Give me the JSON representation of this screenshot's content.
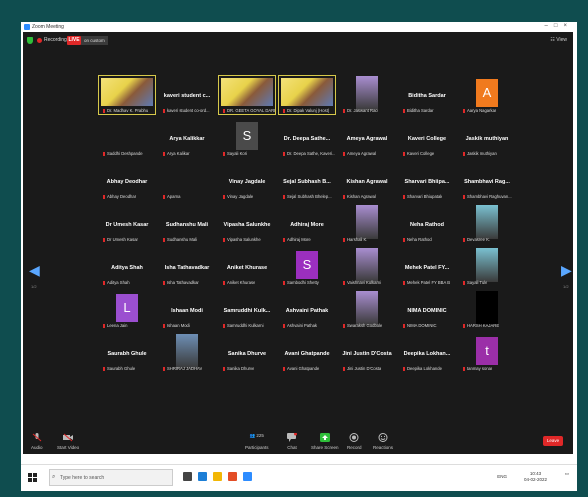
{
  "window": {
    "title": "Zoom Meeting"
  },
  "topbar": {
    "recording_label": "Recording",
    "live_badge": "LIVE",
    "live_stream_label": "on custom",
    "view_label": "View"
  },
  "nav": {
    "prev_page": "1/2",
    "next_page": "1/2"
  },
  "tiles": [
    {
      "type": "poster",
      "caption": "Dr. Madhav K. Prabhu"
    },
    {
      "type": "name",
      "name": "kaveri student c...",
      "caption": "kaveri student co-ord..."
    },
    {
      "type": "poster",
      "caption": "DR. GEETA GOYAL DARE"
    },
    {
      "type": "poster",
      "caption": "Dr. Dipak Valunj (Host)"
    },
    {
      "type": "photo",
      "caption": "Dr. Jaswant Rao"
    },
    {
      "type": "name",
      "name": "Biditha Sardar",
      "caption": "Biditha Sardar"
    },
    {
      "type": "avatar",
      "letter": "A",
      "color": "#f07a1e",
      "caption": "Aarya Nagarkar"
    },
    {
      "type": "name",
      "name": "",
      "caption": "Saddhi Deshpande"
    },
    {
      "type": "name",
      "name": "Arya Kalikkar",
      "caption": "Arya Kalikar"
    },
    {
      "type": "avatar",
      "letter": "S",
      "color": "#4a4a4a",
      "caption": "Sayali Kori"
    },
    {
      "type": "name",
      "name": "Dr. Deepa Sathe...",
      "caption": "Dr. Deepa Sathe, Kaveri..."
    },
    {
      "type": "name",
      "name": "Ameya Agrawal",
      "caption": "Ameya Agrawal"
    },
    {
      "type": "name",
      "name": "Kaveri College",
      "caption": "Kaveri College"
    },
    {
      "type": "name",
      "name": "Jaskik muthiyan",
      "caption": "Jaskik muthiyan"
    },
    {
      "type": "name",
      "name": "Abhay Deodhar",
      "caption": "Abhay Deodhar"
    },
    {
      "type": "name",
      "name": "",
      "caption": "Aparna"
    },
    {
      "type": "name",
      "name": "Vinay Jagdale",
      "caption": "Vinay Jagdale"
    },
    {
      "type": "name",
      "name": "Sejal Subhash B...",
      "caption": "Sejal Subhash Bhelep..."
    },
    {
      "type": "name",
      "name": "Kishan Agrawal",
      "caption": "Kishan Agrawal"
    },
    {
      "type": "name",
      "name": "Sharvari Bhiipa...",
      "caption": "Sharvari Bhiupatak"
    },
    {
      "type": "name",
      "name": "Shambhavi Rag...",
      "caption": "Shambhavi Raghuvan..."
    },
    {
      "type": "name",
      "name": "Dr Umesh Kasar",
      "caption": "Dr Umesh Kasar"
    },
    {
      "type": "name",
      "name": "Sudhanshu Mali",
      "caption": "Sudhanshu Mali"
    },
    {
      "type": "name",
      "name": "Vipasha Salunkhe",
      "caption": "Vipasha Salunkhe"
    },
    {
      "type": "name",
      "name": "Adhiraj More",
      "caption": "Adhiraj More"
    },
    {
      "type": "photo",
      "caption": "Harshali K."
    },
    {
      "type": "name",
      "name": "Neha Rathod",
      "caption": "Neha Rathod"
    },
    {
      "type": "photo",
      "caption": "Devasree K."
    },
    {
      "type": "name",
      "name": "Aditya Shah",
      "caption": "Aditya Shah"
    },
    {
      "type": "name",
      "name": "Isha Tathavadkar",
      "caption": "Isha Tathavadkar"
    },
    {
      "type": "name",
      "name": "Aniket Khurase",
      "caption": "Aniket Khurase"
    },
    {
      "type": "avatar",
      "letter": "S",
      "color": "#9b2fbf",
      "caption": "Sambodhi Shetty"
    },
    {
      "type": "photo",
      "caption": "Vaishnavi Kulkarni"
    },
    {
      "type": "name",
      "name": "Mehek Patel FY...",
      "caption": "Mehek Patel FY BBA B"
    },
    {
      "type": "photo",
      "caption": "Sayali Tule"
    },
    {
      "type": "avatar",
      "letter": "L",
      "color": "#9b4fd0",
      "caption": "Leena Jain"
    },
    {
      "type": "name",
      "name": "Ishaan Modi",
      "caption": "Ishaan Modi"
    },
    {
      "type": "name",
      "name": "Samruddhi Kulk...",
      "caption": "Samruddhi Kulkarni"
    },
    {
      "type": "name",
      "name": "Ashvaini Pathak",
      "caption": "Ashvaini Pathak"
    },
    {
      "type": "photo",
      "caption": "Swaraksh Godbole"
    },
    {
      "type": "name",
      "name": "NIMA DOMINIC",
      "caption": "NIMA DOMINIC"
    },
    {
      "type": "dark",
      "caption": "HARSH KAJARE"
    },
    {
      "type": "name",
      "name": "Saurabh Ghule",
      "caption": "Saurabh Ghule"
    },
    {
      "type": "photo",
      "caption": "SHRIRAJ JADHAV"
    },
    {
      "type": "name",
      "name": "Sanika Dhurve",
      "caption": "Sanika Dhurve"
    },
    {
      "type": "name",
      "name": "Avani Ghatpande",
      "caption": "Avani Ghatpande"
    },
    {
      "type": "name",
      "name": "Jini Justin D'Costa",
      "caption": "Jini Justin D'Costa"
    },
    {
      "type": "name",
      "name": "Deepika Lokhan...",
      "caption": "Deepika Lokhande"
    },
    {
      "type": "avatar",
      "letter": "t",
      "color": "#9b2fa8",
      "caption": "tanmay sonar"
    }
  ],
  "toolbar": {
    "audio": "Audio",
    "start_video": "Start Video",
    "participants": "Participants",
    "participants_count": "225",
    "chat": "Chat",
    "share_screen": "Share Screen",
    "record": "Record",
    "reactions": "Reactions",
    "end": "Leave"
  },
  "taskbar": {
    "search_placeholder": "Type here to search",
    "lang": "ENG",
    "time": "10:43",
    "date": "04-02-2022"
  },
  "colors": {
    "accent": "#2d8cff",
    "live": "#e02828",
    "frame": "#0f4d4f"
  }
}
